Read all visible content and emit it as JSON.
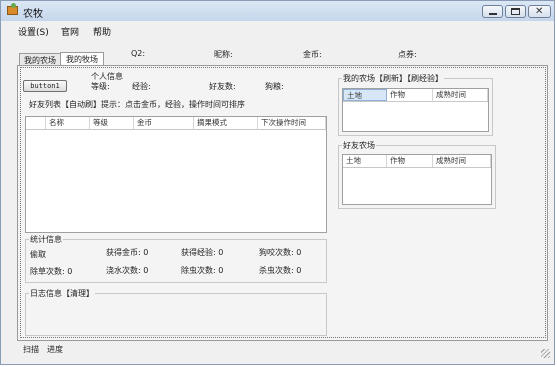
{
  "window": {
    "title": "农牧"
  },
  "menu": [
    "设置(S)",
    "官网",
    "帮助"
  ],
  "info_bar": {
    "qq": "Q2:",
    "nickname": "昵称:",
    "gold": "金币:",
    "coupon": "点券:"
  },
  "tabs": [
    "我的农场",
    "我的牧场"
  ],
  "button": {
    "label": "button1"
  },
  "personal_info": {
    "title": "个人信息",
    "level": "等级:",
    "experience": "经验:",
    "friend_count": "好友数:",
    "dog_food": "狗粮:"
  },
  "friend_list": {
    "title": "好友列表【自动刷】提示：点击金币，经验，操作时间可排序",
    "columns": [
      "",
      "名称",
      "等级",
      "金币",
      "摘果模式",
      "下次操作时间"
    ]
  },
  "my_farm": {
    "title": "我的农场【刷新】【刷经验】",
    "columns": [
      "土地",
      "作物",
      "成熟时间"
    ]
  },
  "friend_farm": {
    "title": "好友农场",
    "columns": [
      "土地",
      "作物",
      "成熟时间"
    ]
  },
  "stats": {
    "title": "统计信息",
    "row1": [
      "偷取",
      "获得金币: 0",
      "获得经验: 0",
      "狗咬次数: 0"
    ],
    "row2": [
      "除草次数: 0",
      "浇水次数: 0",
      "除虫次数: 0",
      "杀虫次数: 0"
    ]
  },
  "log": {
    "title": "日志信息【清理】"
  },
  "status": [
    "扫描",
    "进度"
  ]
}
